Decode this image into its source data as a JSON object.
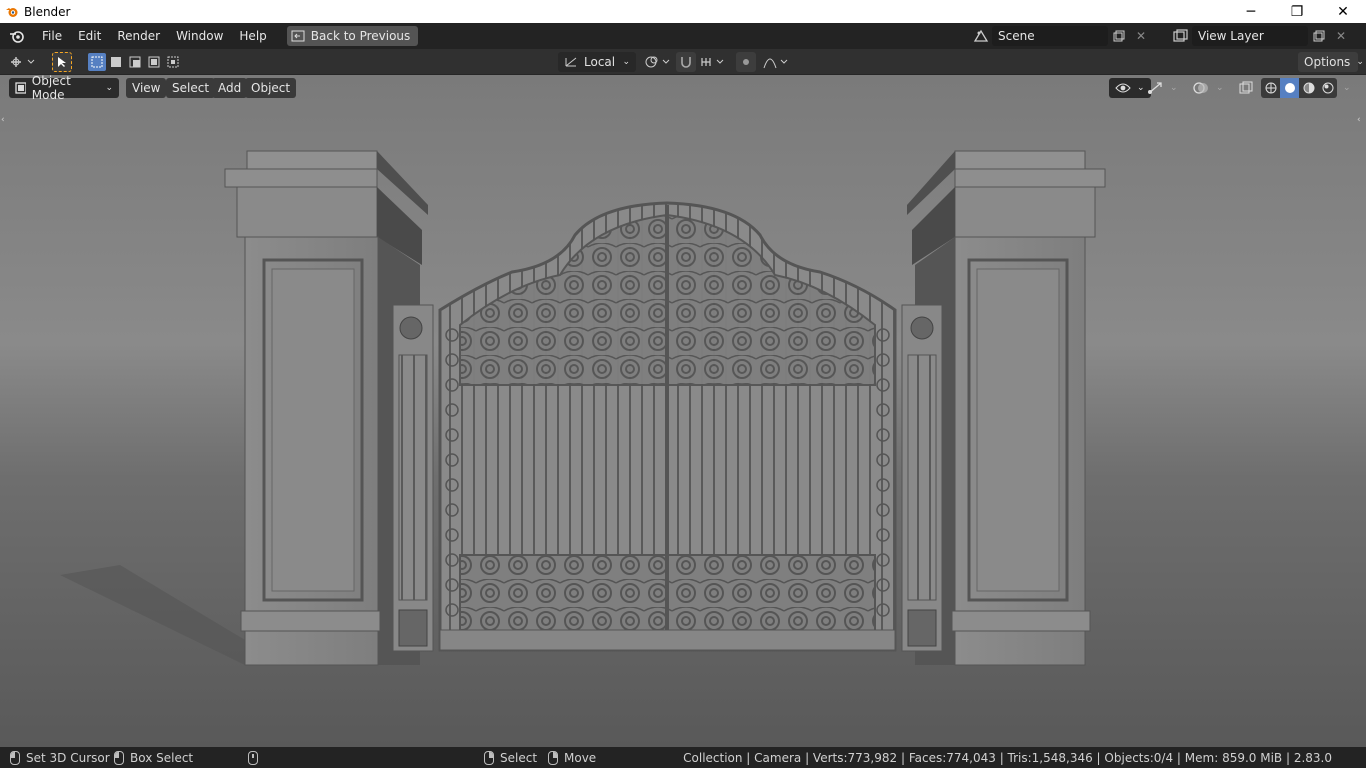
{
  "window": {
    "title": "Blender",
    "controls": {
      "minimize": "─",
      "maximize": "❐",
      "close": "✕"
    }
  },
  "menubar": {
    "items": [
      "File",
      "Edit",
      "Render",
      "Window",
      "Help"
    ],
    "back_button": "Back to Previous",
    "scene": "Scene",
    "view_layer": "View Layer"
  },
  "tool_header": {
    "transform_orientation": "Local",
    "options": "Options"
  },
  "viewport_header": {
    "mode": "Object Mode",
    "menus": [
      "View",
      "Select",
      "Add",
      "Object"
    ]
  },
  "statusbar": {
    "set_cursor": "Set 3D Cursor",
    "box_select": "Box Select",
    "select": "Select",
    "move": "Move",
    "stats": "Collection | Camera | Verts:773,982 | Faces:774,043 | Tris:1,548,346 | Objects:0/4 | Mem: 859.0 MiB | 2.83.0"
  },
  "colors": {
    "accent": "#5680c2",
    "active_tool": "#f5a623"
  },
  "icons": {
    "app": "blender-logo-icon",
    "back": "back-to-previous-icon",
    "scene": "scene-icon",
    "view_layer": "view-layer-icon"
  }
}
